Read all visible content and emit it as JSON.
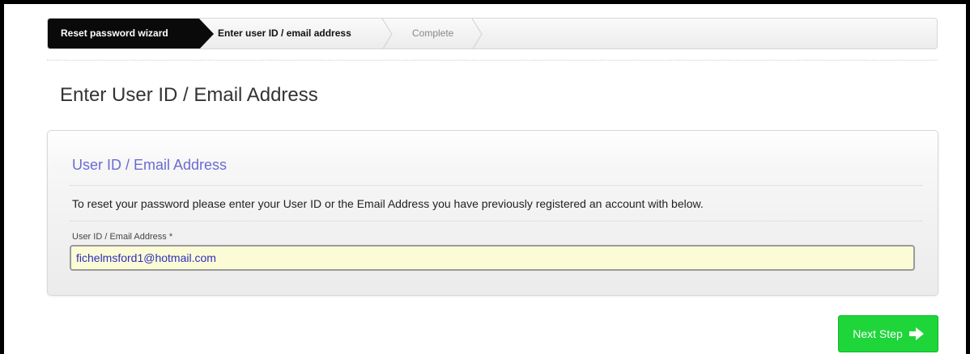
{
  "wizard": {
    "steps": [
      {
        "label": "Reset password wizard",
        "state": "active"
      },
      {
        "label": "Enter user ID / email address",
        "state": "current"
      },
      {
        "label": "Complete",
        "state": "pending"
      }
    ]
  },
  "page": {
    "title": "Enter User ID / Email Address"
  },
  "panel": {
    "title": "User ID / Email Address",
    "instruction": "To reset your password please enter your User ID or the Email Address you have previously registered an account with below.",
    "field": {
      "label": "User ID / Email Address *",
      "value": "fichelmsford1@hotmail.com"
    }
  },
  "actions": {
    "next_label": "Next Step",
    "next_icon": "arrow-right-icon",
    "next_color": "#1ed63a"
  },
  "colors": {
    "panel_title": "#6b6bd3",
    "input_background": "#fbfbd6",
    "wizard_active": "#0a0a0a"
  }
}
